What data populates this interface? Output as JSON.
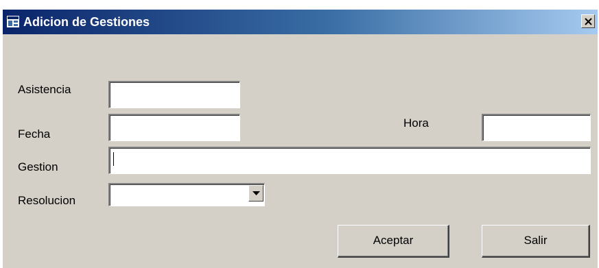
{
  "window": {
    "title": "Adicion de Gestiones"
  },
  "form": {
    "asistencia_label": "Asistencia",
    "asistencia_value": "",
    "fecha_label": "Fecha",
    "fecha_value": "",
    "hora_label": "Hora",
    "hora_value": "",
    "gestion_label": "Gestion",
    "gestion_value": "",
    "resolucion_label": "Resolucion",
    "resolucion_value": ""
  },
  "buttons": {
    "aceptar_label": "Aceptar",
    "salir_label": "Salir"
  },
  "icons": {
    "app": "app-window-icon",
    "close": "close-icon",
    "dropdown": "chevron-down-icon"
  },
  "colors": {
    "titlebar_start": "#0a246a",
    "titlebar_end": "#a6caf0",
    "dialog_background": "#d4d0c8"
  }
}
